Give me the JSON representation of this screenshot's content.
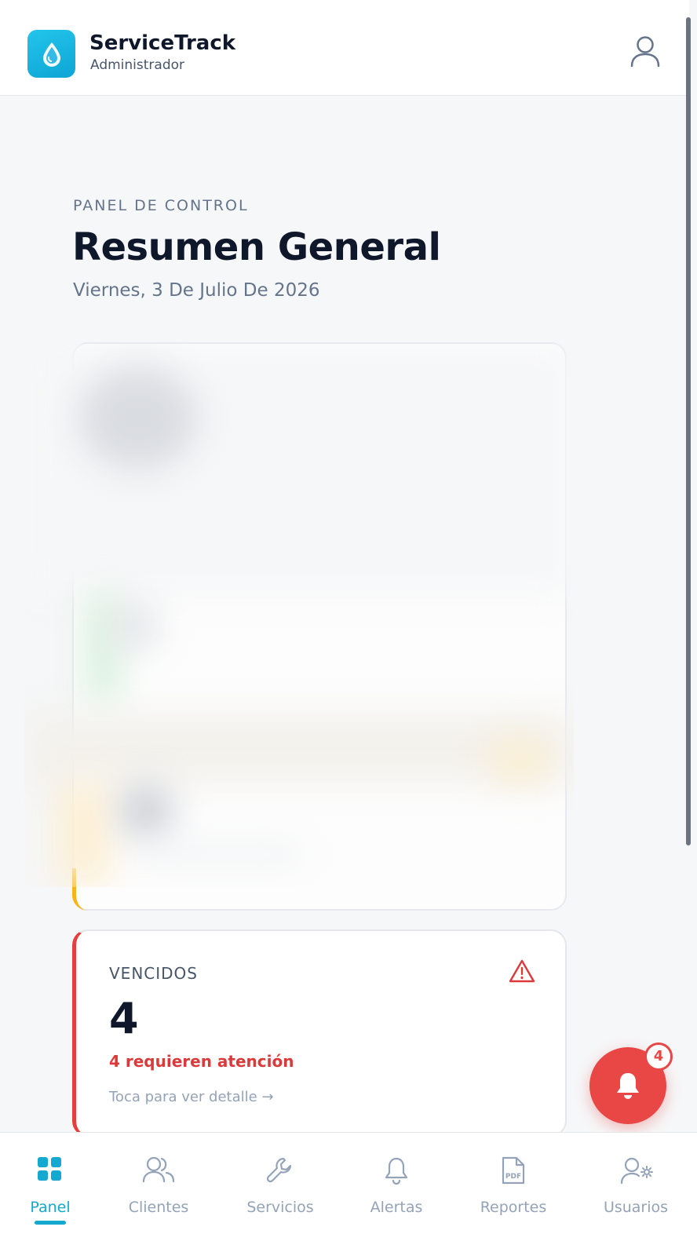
{
  "header": {
    "app_name": "ServiceTrack",
    "role": "Administrador"
  },
  "page": {
    "eyebrow": "PANEL DE CONTROL",
    "title": "Resumen General",
    "date": "Viernes, 3 De Julio De 2026"
  },
  "cards": {
    "vencidos": {
      "label": "VENCIDOS",
      "count": "4",
      "attention": "4 requieren atención",
      "link": "Toca para ver detalle →"
    }
  },
  "notifications": {
    "badge": "4"
  },
  "nav": {
    "items": [
      {
        "label": "Panel",
        "icon": "grid-icon",
        "active": true
      },
      {
        "label": "Clientes",
        "icon": "users-icon",
        "active": false
      },
      {
        "label": "Servicios",
        "icon": "wrench-icon",
        "active": false
      },
      {
        "label": "Alertas",
        "icon": "bell-icon",
        "active": false
      },
      {
        "label": "Reportes",
        "icon": "pdf-icon",
        "active": false
      },
      {
        "label": "Usuarios",
        "icon": "user-settings-icon",
        "active": false
      }
    ]
  },
  "colors": {
    "accent": "#16a9cf",
    "danger": "#e94646",
    "warning": "#f5b51b"
  }
}
